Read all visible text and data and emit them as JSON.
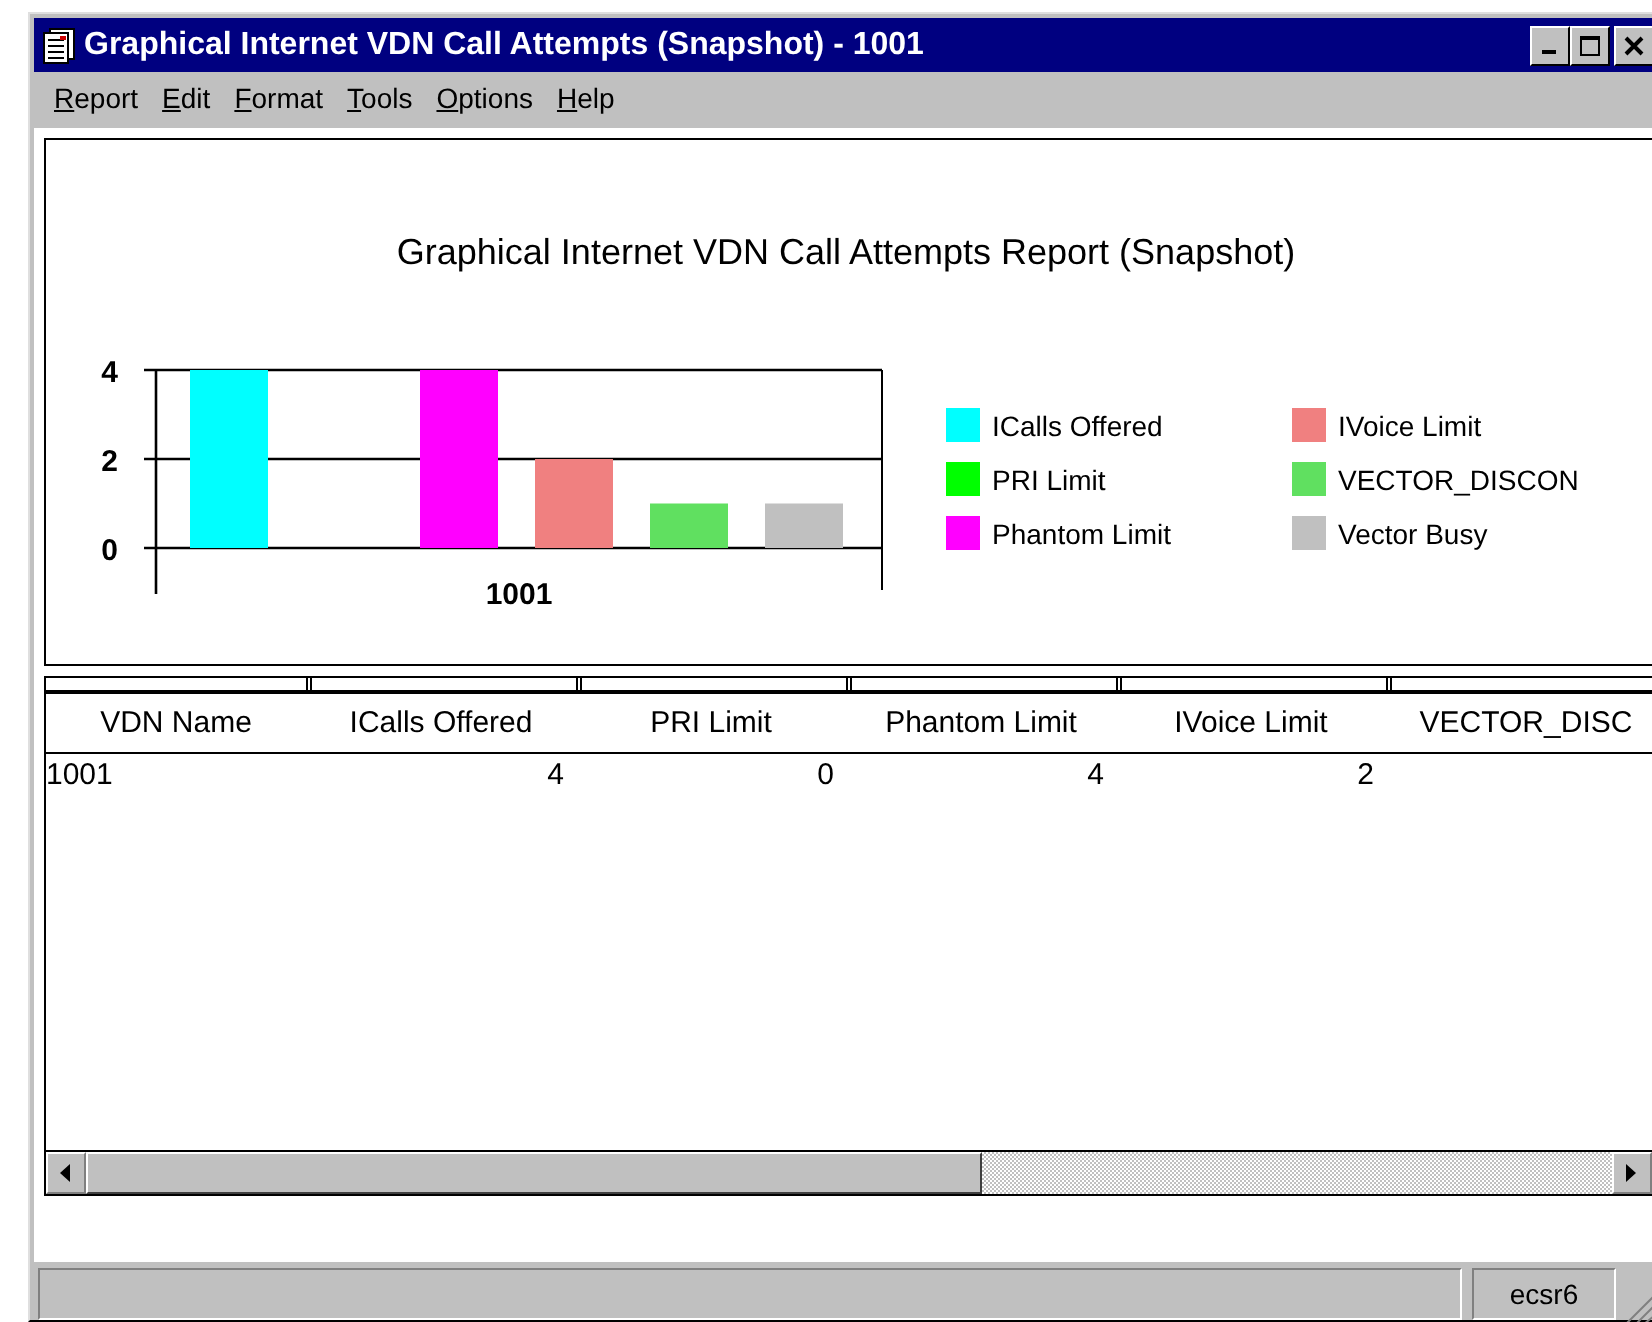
{
  "window": {
    "title": "Graphical Internet VDN Call Attempts (Snapshot) - 1001"
  },
  "menu": [
    {
      "label": "Report"
    },
    {
      "label": "Edit"
    },
    {
      "label": "Format"
    },
    {
      "label": "Tools"
    },
    {
      "label": "Options"
    },
    {
      "label": "Help"
    }
  ],
  "chart": {
    "chart_data": {
      "type": "bar",
      "title": "Graphical Internet VDN Call Attempts Report (Snapshot)",
      "categories": [
        "1001"
      ],
      "yticks": [
        0,
        2,
        4
      ],
      "ylim": [
        0,
        4
      ],
      "legend": "right",
      "series": [
        {
          "name": "ICalls Offered",
          "color": "#00ffff",
          "values": [
            4
          ]
        },
        {
          "name": "PRI Limit",
          "color": "#00ff00",
          "values": [
            0
          ]
        },
        {
          "name": "Phantom Limit",
          "color": "#ff00ff",
          "values": [
            4
          ]
        },
        {
          "name": "IVoice Limit",
          "color": "#f08080",
          "values": [
            2
          ]
        },
        {
          "name": "VECTOR_DISCON",
          "color": "#60e060",
          "values": [
            1
          ]
        },
        {
          "name": "Vector Busy",
          "color": "#c0c0c0",
          "values": [
            1
          ]
        }
      ]
    }
  },
  "table": {
    "columns": [
      "VDN Name",
      "ICalls Offered",
      "PRI Limit",
      "Phantom Limit",
      "IVoice Limit",
      "VECTOR_DISC"
    ],
    "rows": [
      [
        "1001",
        "4",
        "0",
        "4",
        "2"
      ]
    ]
  },
  "status_bar": {
    "server": "ecsr6"
  }
}
